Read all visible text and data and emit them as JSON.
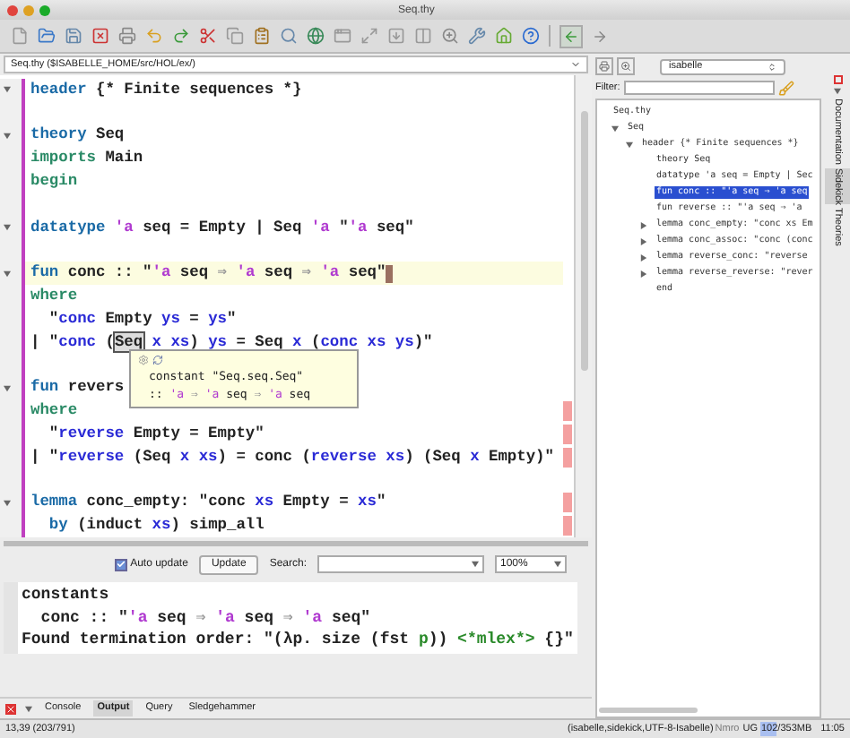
{
  "window": {
    "title": "Seq.thy"
  },
  "editor": {
    "path": "Seq.thy ($ISABELLE_HOME/src/HOL/ex/)",
    "lines": [
      {
        "fold": true,
        "marker": false,
        "current": false,
        "segments": [
          {
            "text": "header",
            "kind": "cmd"
          },
          {
            "text": " {* Finite sequences *}",
            "kind": "plain"
          }
        ]
      },
      {
        "fold": false,
        "marker": false,
        "current": false
      },
      {
        "fold": true,
        "marker": false,
        "current": false,
        "segments": [
          {
            "text": "theory",
            "kind": "cmd"
          },
          {
            "text": " Seq",
            "kind": "plain"
          }
        ]
      },
      {
        "fold": false,
        "marker": false,
        "current": false,
        "segments": [
          {
            "text": "imports",
            "kind": "kw"
          },
          {
            "text": " Main",
            "kind": "plain"
          }
        ]
      },
      {
        "fold": false,
        "marker": false,
        "current": false,
        "segments": [
          {
            "text": "begin",
            "kind": "kw"
          }
        ]
      },
      {
        "fold": false,
        "marker": false,
        "current": false
      },
      {
        "fold": true,
        "marker": false,
        "current": false,
        "segments": [
          {
            "text": "datatype",
            "kind": "cmd"
          },
          {
            "text": " 'a",
            "kind": "tfree"
          },
          {
            "text": " seq = Empty | Seq ",
            "kind": "plain"
          },
          {
            "text": "'a",
            "kind": "tfree"
          },
          {
            "text": " \"",
            "kind": "plain"
          },
          {
            "text": "'a",
            "kind": "tfree"
          },
          {
            "text": " seq\"",
            "kind": "plain"
          }
        ]
      },
      {
        "fold": false,
        "marker": false,
        "current": false
      },
      {
        "fold": true,
        "marker": false,
        "current": true,
        "segments": [
          {
            "text": "fun",
            "kind": "cmd"
          },
          {
            "text": " conc :: \"",
            "kind": "plain"
          },
          {
            "text": "'a",
            "kind": "tfree"
          },
          {
            "text": " seq ",
            "kind": "plain"
          },
          {
            "text": "⇒ ",
            "kind": "sym"
          },
          {
            "text": "'a",
            "kind": "tfree"
          },
          {
            "text": " seq ",
            "kind": "plain"
          },
          {
            "text": "⇒ ",
            "kind": "sym"
          },
          {
            "text": "'a",
            "kind": "tfree"
          },
          {
            "text": " seq\"",
            "kind": "plain"
          }
        ]
      },
      {
        "fold": false,
        "marker": false,
        "current": false,
        "segments": [
          {
            "text": "where",
            "kind": "kw"
          }
        ]
      },
      {
        "fold": false,
        "marker": false,
        "current": false,
        "segments": [
          {
            "text": "  \"",
            "kind": "plain"
          },
          {
            "text": "conc",
            "kind": "free"
          },
          {
            "text": " Empty ",
            "kind": "plain"
          },
          {
            "text": "ys",
            "kind": "free"
          },
          {
            "text": " = ",
            "kind": "plain"
          },
          {
            "text": "ys",
            "kind": "free"
          },
          {
            "text": "\"",
            "kind": "plain"
          }
        ]
      },
      {
        "fold": false,
        "marker": false,
        "current": false,
        "segments": [
          {
            "text": "| \"",
            "kind": "plain"
          },
          {
            "text": "conc",
            "kind": "free"
          },
          {
            "text": " (",
            "kind": "plain"
          },
          {
            "text": "Seq",
            "kind": "hovered"
          },
          {
            "text": " x xs",
            "kind": "free"
          },
          {
            "text": ") ",
            "kind": "plain"
          },
          {
            "text": "ys",
            "kind": "free"
          },
          {
            "text": " = Seq ",
            "kind": "plain"
          },
          {
            "text": "x",
            "kind": "free"
          },
          {
            "text": " (",
            "kind": "plain"
          },
          {
            "text": "conc xs ys",
            "kind": "free"
          },
          {
            "text": ")\"",
            "kind": "plain"
          }
        ]
      },
      {
        "fold": false,
        "marker": false,
        "current": false
      },
      {
        "fold": true,
        "marker": false,
        "current": false,
        "segments": [
          {
            "text": "fun",
            "kind": "cmd"
          },
          {
            "text": " revers",
            "kind": "plain"
          }
        ]
      },
      {
        "fold": false,
        "marker": true,
        "current": false,
        "segments": [
          {
            "text": "where",
            "kind": "kw"
          }
        ]
      },
      {
        "fold": false,
        "marker": true,
        "current": false,
        "segments": [
          {
            "text": "  \"",
            "kind": "plain"
          },
          {
            "text": "reverse",
            "kind": "free"
          },
          {
            "text": " Empty = Empty\"",
            "kind": "plain"
          }
        ]
      },
      {
        "fold": false,
        "marker": true,
        "current": false,
        "segments": [
          {
            "text": "| \"",
            "kind": "plain"
          },
          {
            "text": "reverse",
            "kind": "free"
          },
          {
            "text": " (Seq ",
            "kind": "plain"
          },
          {
            "text": "x xs",
            "kind": "free"
          },
          {
            "text": ") = conc (",
            "kind": "plain"
          },
          {
            "text": "reverse xs",
            "kind": "free"
          },
          {
            "text": ") (Seq ",
            "kind": "plain"
          },
          {
            "text": "x",
            "kind": "free"
          },
          {
            "text": " Empty)\"",
            "kind": "plain"
          }
        ]
      },
      {
        "fold": false,
        "marker": false,
        "current": false
      },
      {
        "fold": true,
        "marker": true,
        "current": false,
        "segments": [
          {
            "text": "lemma",
            "kind": "cmd"
          },
          {
            "text": " conc_empty: \"conc ",
            "kind": "plain"
          },
          {
            "text": "xs",
            "kind": "free"
          },
          {
            "text": " Empty = ",
            "kind": "plain"
          },
          {
            "text": "xs",
            "kind": "free"
          },
          {
            "text": "\"",
            "kind": "plain"
          }
        ]
      },
      {
        "fold": false,
        "marker": true,
        "current": false,
        "segments": [
          {
            "text": "  by",
            "kind": "cmd"
          },
          {
            "text": " (induct ",
            "kind": "plain"
          },
          {
            "text": "xs",
            "kind": "free"
          },
          {
            "text": ") simp_all",
            "kind": "plain"
          }
        ]
      }
    ],
    "tooltip": {
      "lines": [
        [
          {
            "text": "constant \"Seq.seq.Seq\"",
            "kind": "plain"
          }
        ],
        [
          {
            "text": ":: ",
            "kind": "plain"
          },
          {
            "text": "'a",
            "kind": "tfree"
          },
          {
            "text": " ⇒ ",
            "kind": "sym"
          },
          {
            "text": "'a",
            "kind": "tfree"
          },
          {
            "text": " seq ",
            "kind": "plain"
          },
          {
            "text": "⇒ ",
            "kind": "sym"
          },
          {
            "text": "'a",
            "kind": "tfree"
          },
          {
            "text": " seq",
            "kind": "plain"
          }
        ]
      ]
    }
  },
  "output": {
    "auto_update": {
      "label": "Auto update",
      "checked": true
    },
    "update_button": "Update",
    "search_label": "Search:",
    "zoom": "100%",
    "lines": [
      [
        {
          "text": "constants",
          "kind": "plain"
        }
      ],
      [
        {
          "text": "  conc :: \"",
          "kind": "plain"
        },
        {
          "text": "'a",
          "kind": "tfree"
        },
        {
          "text": " seq ",
          "kind": "plain"
        },
        {
          "text": "⇒ ",
          "kind": "sym"
        },
        {
          "text": "'a",
          "kind": "tfree"
        },
        {
          "text": " seq ",
          "kind": "plain"
        },
        {
          "text": "⇒ ",
          "kind": "sym"
        },
        {
          "text": "'a",
          "kind": "tfree"
        },
        {
          "text": " seq\"",
          "kind": "plain"
        }
      ],
      [
        {
          "text": "Found termination order: \"(λp. size (fst ",
          "kind": "plain"
        },
        {
          "text": "p",
          "kind": "bound"
        },
        {
          "text": ")) ",
          "kind": "plain"
        },
        {
          "text": "<*mlex*>",
          "kind": "bound"
        },
        {
          "text": " {}\"",
          "kind": "plain"
        }
      ]
    ]
  },
  "dock_tabs": [
    {
      "label": "Console",
      "selected": false
    },
    {
      "label": "Output",
      "selected": true
    },
    {
      "label": "Query",
      "selected": false
    },
    {
      "label": "Sledgehammer",
      "selected": false
    }
  ],
  "sidekick": {
    "mode": "isabelle",
    "filter_label": "Filter:",
    "tree": [
      {
        "label": "Seq.thy",
        "children": [
          {
            "label": "Seq",
            "expanded": true,
            "children": [
              {
                "label": "header {* Finite sequences *}",
                "expanded": true,
                "children": [
                  {
                    "label": "theory Seq",
                    "selected": false
                  },
                  {
                    "label": "datatype 'a seq = Empty | Sec",
                    "selected": false
                  },
                  {
                    "label": "fun conc :: \"'a seq ⇒ 'a seq",
                    "selected": true
                  },
                  {
                    "label": "fun reverse :: \"'a seq ⇒ 'a",
                    "selected": false
                  },
                  {
                    "label": "lemma conc_empty: \"conc xs Em",
                    "selected": false,
                    "expandable": true
                  },
                  {
                    "label": "lemma conc_assoc: \"conc (conc",
                    "selected": false,
                    "expandable": true
                  },
                  {
                    "label": "lemma reverse_conc: \"reverse",
                    "selected": false,
                    "expandable": true
                  },
                  {
                    "label": "lemma reverse_reverse: \"rever",
                    "selected": false,
                    "expandable": true
                  },
                  {
                    "label": "end",
                    "selected": false
                  }
                ]
              }
            ]
          }
        ]
      }
    ]
  },
  "side_tabs": [
    {
      "label": "Documentation",
      "selected": false
    },
    {
      "label": "Sidekick",
      "selected": true
    },
    {
      "label": "Theories",
      "selected": false
    }
  ],
  "status_bar": {
    "position": "13,39 (203/791)",
    "mode": "(isabelle,sidekick,UTF-8-Isabelle)",
    "flags": "Nmro",
    "ug": "UG",
    "memory": {
      "text": "102/353MB",
      "level": 0.3
    },
    "time": "11:05"
  }
}
